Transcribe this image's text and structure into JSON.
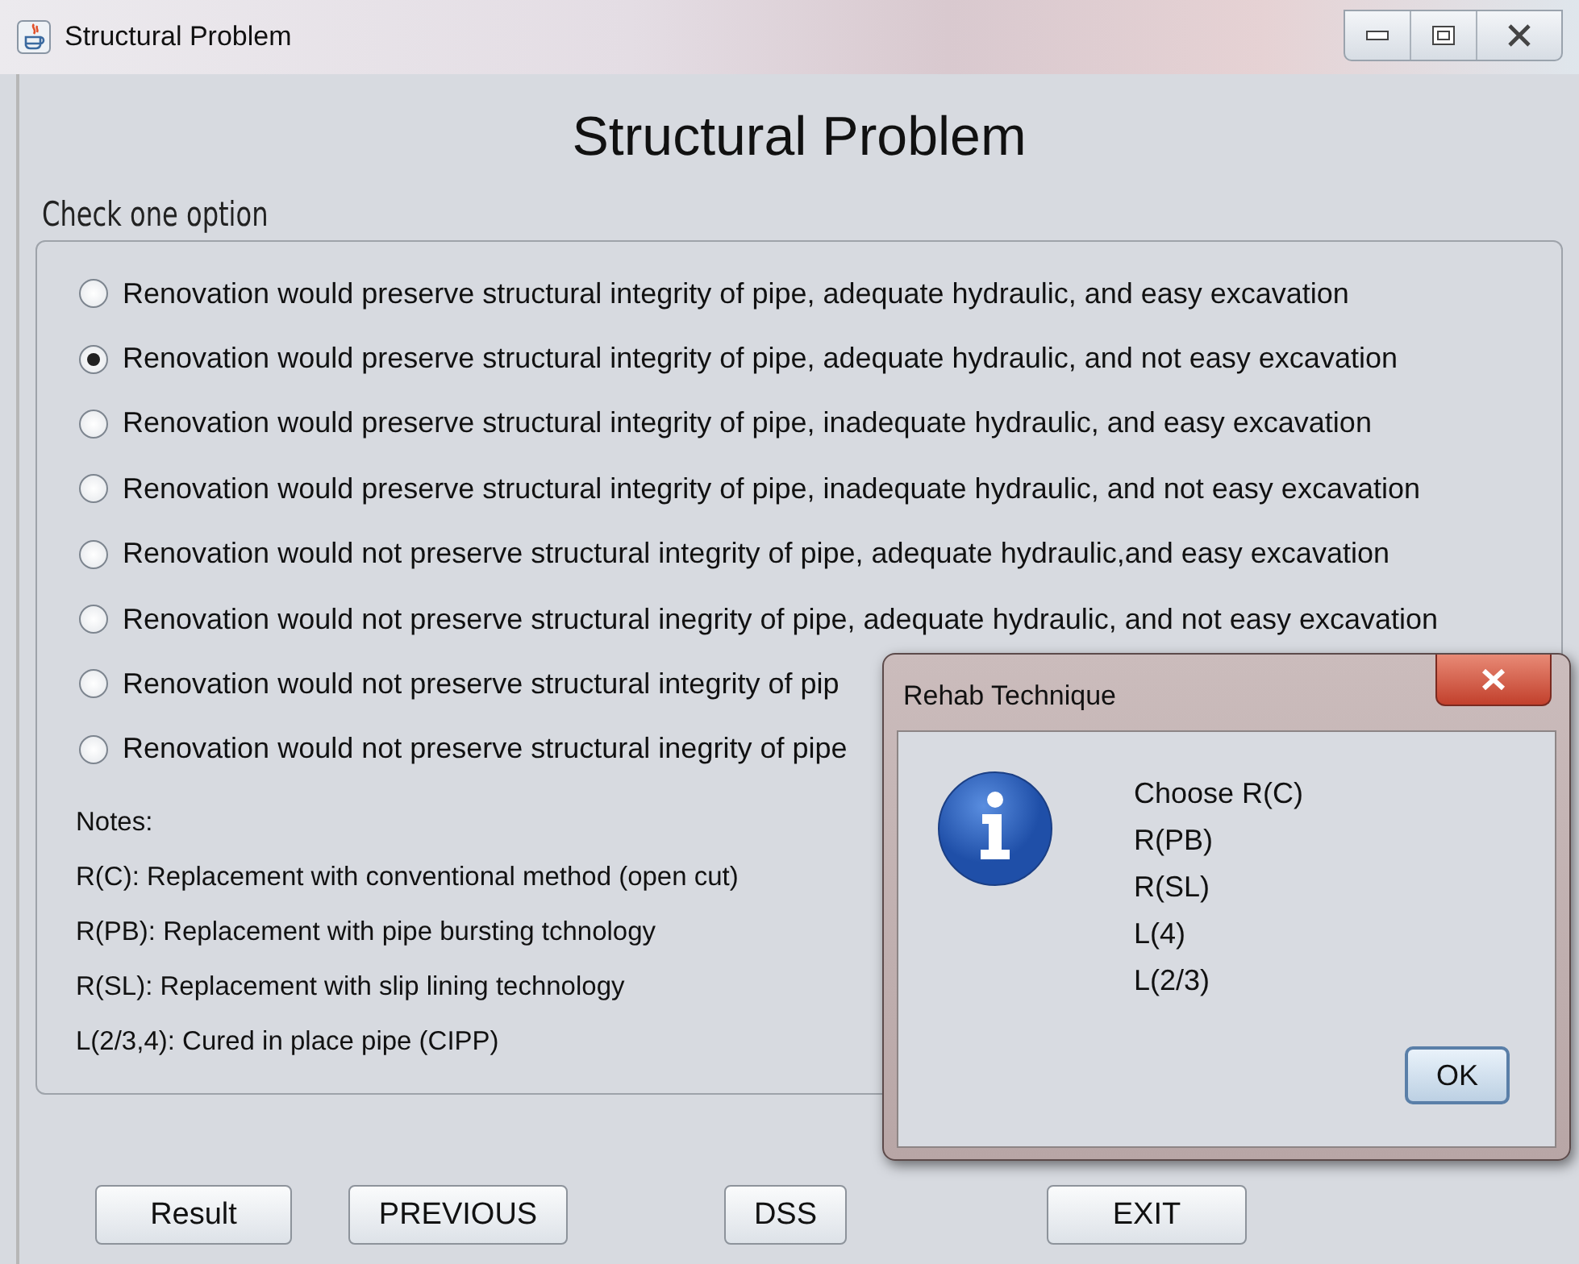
{
  "window": {
    "title": "Structural Problem"
  },
  "heading": "Structural Problem",
  "group_label": "Check one option",
  "options": [
    {
      "label": "Renovation would preserve structural integrity of pipe, adequate hydraulic, and easy excavation",
      "selected": false
    },
    {
      "label": "Renovation would preserve structural integrity of pipe, adequate hydraulic, and not easy excavation",
      "selected": true
    },
    {
      "label": "Renovation would preserve structural integrity of pipe, inadequate hydraulic, and easy excavation",
      "selected": false
    },
    {
      "label": "Renovation would preserve structural integrity of pipe, inadequate hydraulic, and not easy excavation",
      "selected": false
    },
    {
      "label": "Renovation would not preserve structural integrity of pipe, adequate hydraulic,and easy excavation",
      "selected": false
    },
    {
      "label": "Renovation would not preserve structural inegrity of pipe,  adequate hydraulic, and not easy excavation",
      "selected": false
    },
    {
      "label": "Renovation would not preserve structural integrity of pip",
      "selected": false
    },
    {
      "label": "Renovation would not preserve structural inegrity of pipe",
      "selected": false
    }
  ],
  "notes": [
    "Notes:",
    "R(C): Replacement with conventional method (open cut)",
    "R(PB): Replacement with pipe bursting tchnology",
    "R(SL): Replacement with slip lining technology",
    "L(2/3,4): Cured in place pipe (CIPP)"
  ],
  "buttons": [
    "Result",
    "PREVIOUS",
    "DSS",
    "EXIT"
  ],
  "dialog": {
    "title": "Rehab Technique",
    "lines": [
      "Choose R(C)",
      "R(PB)",
      "R(SL)",
      "L(4)",
      "L(2/3)"
    ],
    "button": "OK"
  }
}
